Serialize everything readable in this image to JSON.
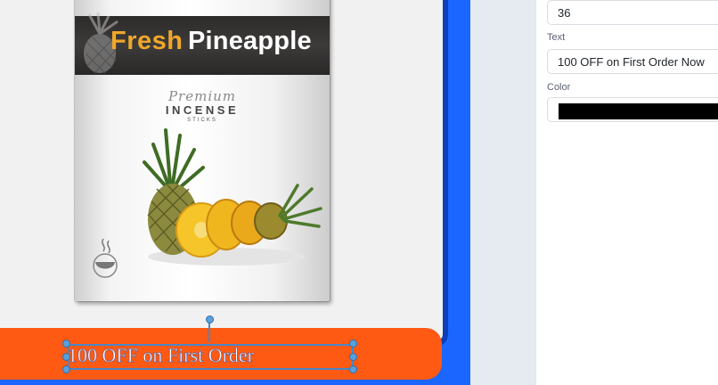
{
  "editor": {
    "package": {
      "brand_first": "Fresh",
      "brand_second": "Pineapple",
      "premium": "Premium",
      "product": "INCENSE",
      "subtitle": "STICKS"
    },
    "selected_text": "100 OFF on First Order",
    "colors": {
      "banner": "#ff5a14",
      "frame": "#1a66ff",
      "selection": "#4a86c8"
    }
  },
  "properties": {
    "font_size_value": "36",
    "text_label": "Text",
    "text_value": "100 OFF on First Order Now",
    "color_label": "Color",
    "color_value": "#000000"
  }
}
